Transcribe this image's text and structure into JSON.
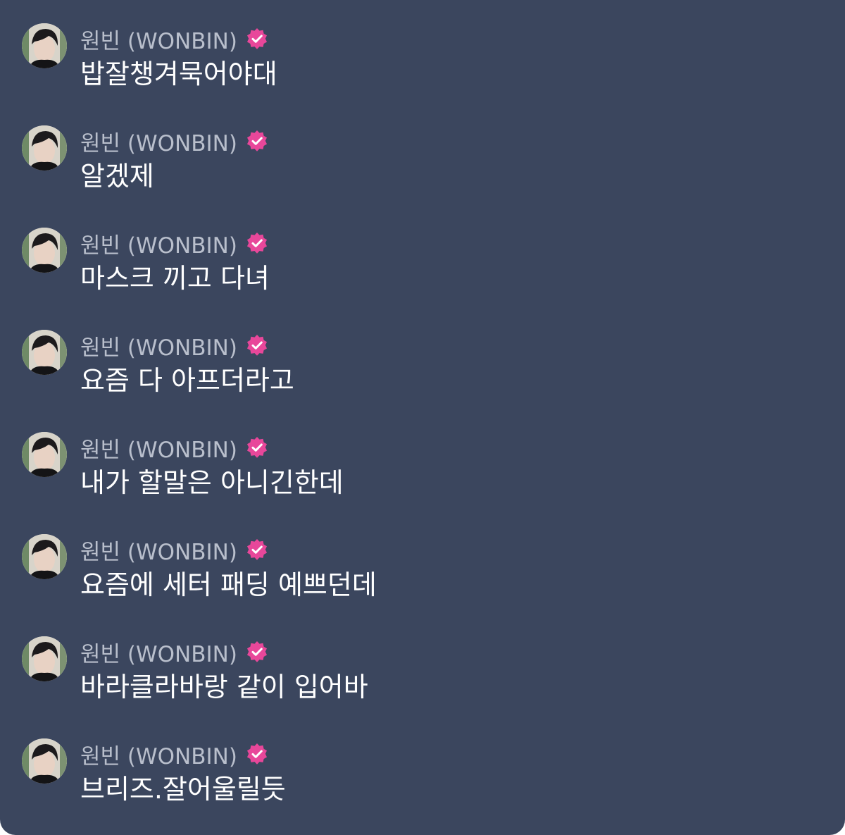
{
  "sender": {
    "name": "원빈 (WONBIN)",
    "verified_icon": "verified-badge-icon",
    "verified_color": "#e8479a"
  },
  "colors": {
    "background": "#3b465e",
    "sender_text": "#b9bfcc",
    "message_text": "#ffffff"
  },
  "messages": [
    {
      "text": "밥잘챙겨묵어야대"
    },
    {
      "text": "알겠제"
    },
    {
      "text": "마스크 끼고 다녀"
    },
    {
      "text": "요즘 다 아프더라고"
    },
    {
      "text": "내가 할말은 아니긴한데"
    },
    {
      "text": "요즘에 세터 패딩 예쁘던데"
    },
    {
      "text": "바라클라바랑 같이 입어바"
    },
    {
      "text": "브리즈.잘어울릴듯"
    }
  ]
}
